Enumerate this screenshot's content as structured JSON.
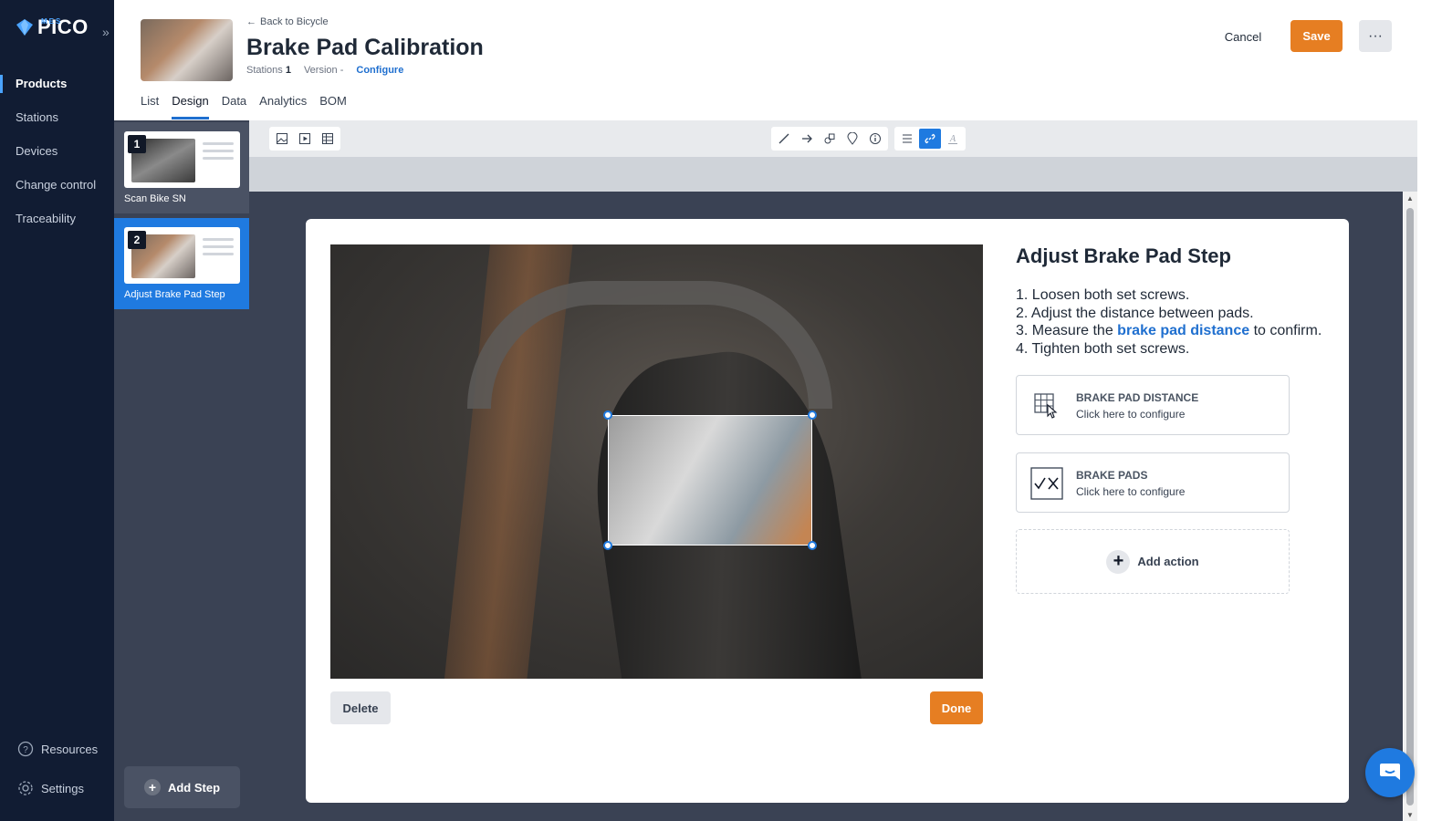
{
  "app": {
    "logo_text": "PICO",
    "logo_sub": "MES"
  },
  "nav": {
    "items": [
      {
        "label": "Products",
        "active": true
      },
      {
        "label": "Stations",
        "active": false
      },
      {
        "label": "Devices",
        "active": false
      },
      {
        "label": "Change control",
        "active": false
      },
      {
        "label": "Traceability",
        "active": false
      }
    ],
    "resources_label": "Resources",
    "settings_label": "Settings"
  },
  "header": {
    "back_label": "Back to Bicycle",
    "title": "Brake Pad Calibration",
    "stations_label": "Stations",
    "stations_value": "1",
    "version_label": "Version",
    "version_value": "-",
    "configure_label": "Configure",
    "cancel_label": "Cancel",
    "save_label": "Save",
    "more_label": "···",
    "tabs": [
      {
        "label": "List",
        "active": false
      },
      {
        "label": "Design",
        "active": true
      },
      {
        "label": "Data",
        "active": false
      },
      {
        "label": "Analytics",
        "active": false
      },
      {
        "label": "BOM",
        "active": false
      }
    ]
  },
  "steps": [
    {
      "number": "1",
      "label": "Scan Bike SN",
      "selected": false
    },
    {
      "number": "2",
      "label": "Adjust Brake Pad Step",
      "selected": true
    }
  ],
  "add_step_label": "Add Step",
  "toolbar": {
    "left_tools": [
      "image-icon",
      "video-icon",
      "table-icon"
    ],
    "shape_tools": [
      "line-icon",
      "arrow-icon",
      "shapes-icon",
      "marker-icon",
      "info-icon"
    ],
    "text_tools": [
      "align-icon",
      "link-icon",
      "text-color-icon"
    ],
    "active_tool": "link-icon"
  },
  "editor": {
    "step_title": "Adjust Brake Pad Step",
    "instructions": {
      "line1": "1. Loosen both set screws.",
      "line2": "2. Adjust the distance between pads.",
      "line3_before": "3. Measure the ",
      "line3_link": "brake pad distance",
      "line3_after": " to confirm.",
      "line4": "4. Tighten both set screws."
    },
    "actions": [
      {
        "title": "BRAKE PAD DISTANCE",
        "subtitle": "Click here to configure",
        "icon": "table-pointer-icon"
      },
      {
        "title": "BRAKE PADS",
        "subtitle": "Click here to configure",
        "icon": "check-cross-icon"
      }
    ],
    "add_action_label": "Add action",
    "delete_label": "Delete",
    "done_label": "Done"
  },
  "colors": {
    "accent": "#e67e22",
    "primary": "#1f7ae0",
    "nav_bg": "#111c33"
  }
}
